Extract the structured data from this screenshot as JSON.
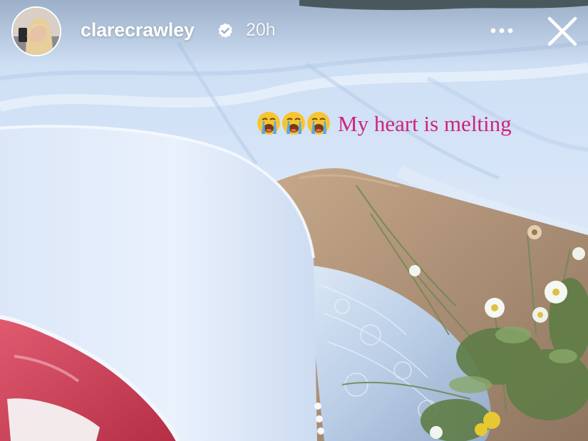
{
  "story": {
    "username": "clarecrawley",
    "verified": true,
    "timestamp": "20h",
    "caption": {
      "emojis": [
        "loudly-crying-face-emoji",
        "loudly-crying-face-emoji",
        "loudly-crying-face-emoji"
      ],
      "text": "My heart is melting",
      "color": "#d0237a"
    }
  },
  "icons": {
    "verified": "verified-badge-icon",
    "more": "more-options-icon",
    "close": "close-icon"
  },
  "colors": {
    "header_text": "#ffffff",
    "caption_text": "#d0237a",
    "blanket": "#dbe8f8",
    "cake_fondant": "#e6effb",
    "cake_interior": "#d0405a",
    "board": "#b09070"
  }
}
